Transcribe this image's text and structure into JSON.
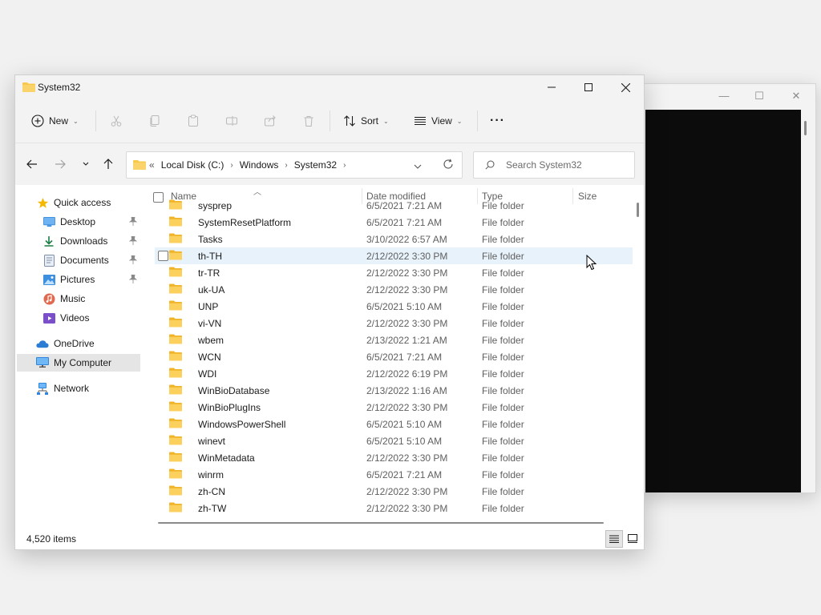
{
  "background_window": {
    "controls": [
      "—",
      "☐",
      "✕"
    ]
  },
  "window": {
    "title": "System32",
    "controls": {
      "minimize": "—",
      "maximize": "☐",
      "close": "✕"
    }
  },
  "toolbar": {
    "new_label": "New",
    "sort_label": "Sort",
    "view_label": "View",
    "more_label": "···"
  },
  "address": {
    "overflow": "«",
    "crumbs": [
      "Local Disk (C:)",
      "Windows",
      "System32"
    ]
  },
  "search": {
    "placeholder": "Search System32"
  },
  "nav": {
    "items": [
      {
        "label": "Quick access"
      },
      {
        "label": "Desktop"
      },
      {
        "label": "Downloads"
      },
      {
        "label": "Documents"
      },
      {
        "label": "Pictures"
      },
      {
        "label": "Music"
      },
      {
        "label": "Videos"
      },
      {
        "label": "OneDrive"
      },
      {
        "label": "My Computer"
      },
      {
        "label": "Network"
      }
    ]
  },
  "columns": {
    "name": "Name",
    "date": "Date modified",
    "type": "Type",
    "size": "Size"
  },
  "files": [
    {
      "name": "sysprep",
      "date": "6/5/2021 7:21 AM",
      "type": "File folder"
    },
    {
      "name": "SystemResetPlatform",
      "date": "6/5/2021 7:21 AM",
      "type": "File folder"
    },
    {
      "name": "Tasks",
      "date": "3/10/2022 6:57 AM",
      "type": "File folder"
    },
    {
      "name": "th-TH",
      "date": "2/12/2022 3:30 PM",
      "type": "File folder"
    },
    {
      "name": "tr-TR",
      "date": "2/12/2022 3:30 PM",
      "type": "File folder"
    },
    {
      "name": "uk-UA",
      "date": "2/12/2022 3:30 PM",
      "type": "File folder"
    },
    {
      "name": "UNP",
      "date": "6/5/2021 5:10 AM",
      "type": "File folder"
    },
    {
      "name": "vi-VN",
      "date": "2/12/2022 3:30 PM",
      "type": "File folder"
    },
    {
      "name": "wbem",
      "date": "2/13/2022 1:21 AM",
      "type": "File folder"
    },
    {
      "name": "WCN",
      "date": "6/5/2021 7:21 AM",
      "type": "File folder"
    },
    {
      "name": "WDI",
      "date": "2/12/2022 6:19 PM",
      "type": "File folder"
    },
    {
      "name": "WinBioDatabase",
      "date": "2/13/2022 1:16 AM",
      "type": "File folder"
    },
    {
      "name": "WinBioPlugIns",
      "date": "2/12/2022 3:30 PM",
      "type": "File folder"
    },
    {
      "name": "WindowsPowerShell",
      "date": "6/5/2021 5:10 AM",
      "type": "File folder"
    },
    {
      "name": "winevt",
      "date": "6/5/2021 5:10 AM",
      "type": "File folder"
    },
    {
      "name": "WinMetadata",
      "date": "2/12/2022 3:30 PM",
      "type": "File folder"
    },
    {
      "name": "winrm",
      "date": "6/5/2021 7:21 AM",
      "type": "File folder"
    },
    {
      "name": "zh-CN",
      "date": "2/12/2022 3:30 PM",
      "type": "File folder"
    },
    {
      "name": "zh-TW",
      "date": "2/12/2022 3:30 PM",
      "type": "File folder"
    }
  ],
  "status": {
    "item_count": "4,520 items"
  },
  "colors": {
    "accent": "#0067c0",
    "folder": "#f8c84a",
    "hover_row": "#e8f2fb"
  }
}
